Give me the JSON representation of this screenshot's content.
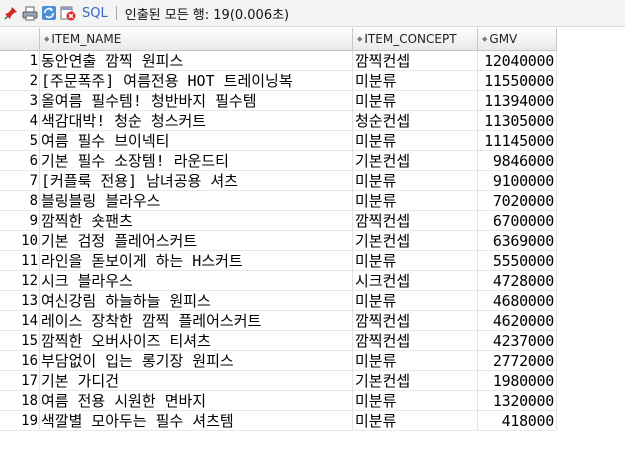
{
  "toolbar": {
    "sql_label": "SQL",
    "status_text": "인출된 모든 행: 19(0.006초)"
  },
  "columns": [
    "ITEM_NAME",
    "ITEM_CONCEPT",
    "GMV"
  ],
  "rows": [
    {
      "num": "1",
      "name": "동안연출 깜찍 원피스",
      "concept": "깜찍컨셉",
      "gmv": "12040000"
    },
    {
      "num": "2",
      "name": "[주문폭주] 여름전용 HOT 트레이닝복",
      "concept": "미분류",
      "gmv": "11550000"
    },
    {
      "num": "3",
      "name": "올여름 필수템! 청반바지 필수템",
      "concept": "미분류",
      "gmv": "11394000"
    },
    {
      "num": "4",
      "name": "색감대박! 청순 청스커트",
      "concept": "청순컨셉",
      "gmv": "11305000"
    },
    {
      "num": "5",
      "name": "여름 필수 브이넥티",
      "concept": "미분류",
      "gmv": "11145000"
    },
    {
      "num": "6",
      "name": "기본 필수 소장템! 라운드티",
      "concept": "기본컨셉",
      "gmv": "9846000"
    },
    {
      "num": "7",
      "name": "[커플룩 전용] 남녀공용 셔츠",
      "concept": "미분류",
      "gmv": "9100000"
    },
    {
      "num": "8",
      "name": "블링블링 블라우스",
      "concept": "미분류",
      "gmv": "7020000"
    },
    {
      "num": "9",
      "name": "깜찍한 숏팬츠",
      "concept": "깜찍컨셉",
      "gmv": "6700000"
    },
    {
      "num": "10",
      "name": "기본 검정 플레어스커트",
      "concept": "기본컨셉",
      "gmv": "6369000"
    },
    {
      "num": "11",
      "name": "라인을 돋보이게 하는 H스커트",
      "concept": "미분류",
      "gmv": "5550000"
    },
    {
      "num": "12",
      "name": "시크 블라우스",
      "concept": "시크컨셉",
      "gmv": "4728000"
    },
    {
      "num": "13",
      "name": "여신강림 하늘하늘 원피스",
      "concept": "미분류",
      "gmv": "4680000"
    },
    {
      "num": "14",
      "name": "레이스 장착한 깜찍 플레어스커트",
      "concept": "깜찍컨셉",
      "gmv": "4620000"
    },
    {
      "num": "15",
      "name": "깜찍한 오버사이즈 티셔츠",
      "concept": "깜찍컨셉",
      "gmv": "4237000"
    },
    {
      "num": "16",
      "name": "부담없이 입는 롱기장 원피스",
      "concept": "미분류",
      "gmv": "2772000"
    },
    {
      "num": "17",
      "name": "기본 가디건",
      "concept": "기본컨셉",
      "gmv": "1980000"
    },
    {
      "num": "18",
      "name": "여름 전용 시원한 면바지",
      "concept": "미분류",
      "gmv": "1320000"
    },
    {
      "num": "19",
      "name": "색깔별 모아두는 필수 셔츠템",
      "concept": "미분류",
      "gmv": "418000"
    }
  ]
}
